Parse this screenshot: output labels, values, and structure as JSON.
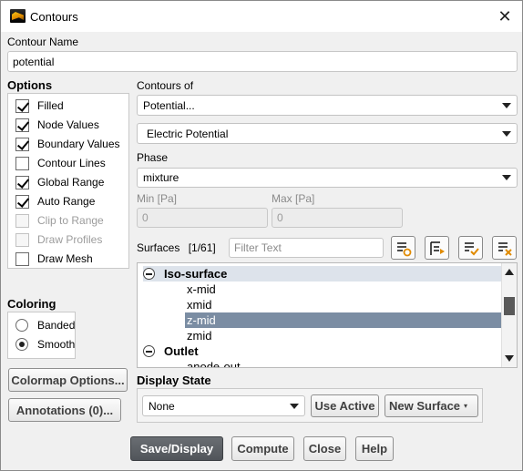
{
  "window": {
    "title": "Contours",
    "app_icon": "fluent-logo-icon",
    "close_icon": "close-icon"
  },
  "contour_name": {
    "label": "Contour Name",
    "value": "potential"
  },
  "options": {
    "label": "Options",
    "items": [
      {
        "label": "Filled",
        "checked": true,
        "enabled": true
      },
      {
        "label": "Node Values",
        "checked": true,
        "enabled": true
      },
      {
        "label": "Boundary Values",
        "checked": true,
        "enabled": true
      },
      {
        "label": "Contour Lines",
        "checked": false,
        "enabled": true
      },
      {
        "label": "Global Range",
        "checked": true,
        "enabled": true
      },
      {
        "label": "Auto Range",
        "checked": true,
        "enabled": true
      },
      {
        "label": "Clip to Range",
        "checked": false,
        "enabled": false
      },
      {
        "label": "Draw Profiles",
        "checked": false,
        "enabled": false
      },
      {
        "label": "Draw Mesh",
        "checked": false,
        "enabled": true
      }
    ]
  },
  "coloring": {
    "label": "Coloring",
    "options": [
      {
        "label": "Banded",
        "selected": false
      },
      {
        "label": "Smooth",
        "selected": true
      }
    ]
  },
  "buttons_left": {
    "colormap": "Colormap Options...",
    "annotations": "Annotations (0)..."
  },
  "contours_of": {
    "label": "Contours of",
    "category": "Potential...",
    "variable": "Electric Potential"
  },
  "phase": {
    "label": "Phase",
    "value": "mixture"
  },
  "range": {
    "min_label": "Min [Pa]",
    "min_value": "0",
    "max_label": "Max [Pa]",
    "max_value": "0"
  },
  "surfaces": {
    "label": "Surfaces",
    "count": "[1/61]",
    "filter_placeholder": "Filter Text",
    "tool_icons": [
      "new-surface-icon",
      "select-filter-icon",
      "select-all-icon",
      "deselect-all-icon"
    ],
    "items": [
      {
        "label": "Iso-surface",
        "type": "group",
        "expanded": true
      },
      {
        "label": "x-mid",
        "type": "item",
        "selected": false
      },
      {
        "label": "xmid",
        "type": "item",
        "selected": false
      },
      {
        "label": "z-mid",
        "type": "item",
        "selected": true
      },
      {
        "label": "zmid",
        "type": "item",
        "selected": false
      },
      {
        "label": "Outlet",
        "type": "group",
        "expanded": true
      },
      {
        "label": "anode-out",
        "type": "item",
        "selected": false
      }
    ]
  },
  "display_state": {
    "label": "Display State",
    "value": "None",
    "use_active": "Use Active",
    "new_surface": "New Surface"
  },
  "footer": {
    "save_display": "Save/Display",
    "compute": "Compute",
    "close": "Close",
    "help": "Help"
  }
}
